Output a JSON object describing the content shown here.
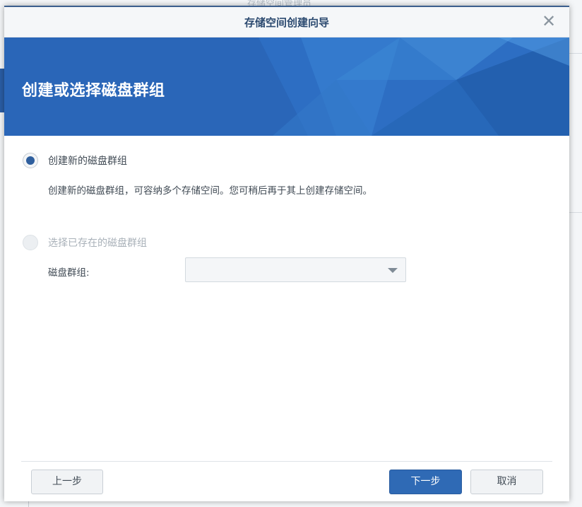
{
  "background": {
    "app_title": "存储空间管理员"
  },
  "dialog": {
    "title": "存储空间创建向导",
    "close_glyph": "✕",
    "banner_title": "创建或选择磁盘群组"
  },
  "options": {
    "create_new": {
      "label": "创建新的磁盘群组",
      "description": "创建新的磁盘群组，可容纳多个存储空间。您可稍后再于其上创建存储空间。",
      "selected": true
    },
    "select_existing": {
      "label": "选择已存在的磁盘群组",
      "selected": false,
      "enabled": false,
      "field_label": "磁盘群组:",
      "field_value": ""
    }
  },
  "footer": {
    "prev_label": "上一步",
    "next_label": "下一步",
    "cancel_label": "取消"
  },
  "colors": {
    "accent": "#2f6ab5",
    "banner": "#2a66b8",
    "title_text": "#2c4a70"
  }
}
